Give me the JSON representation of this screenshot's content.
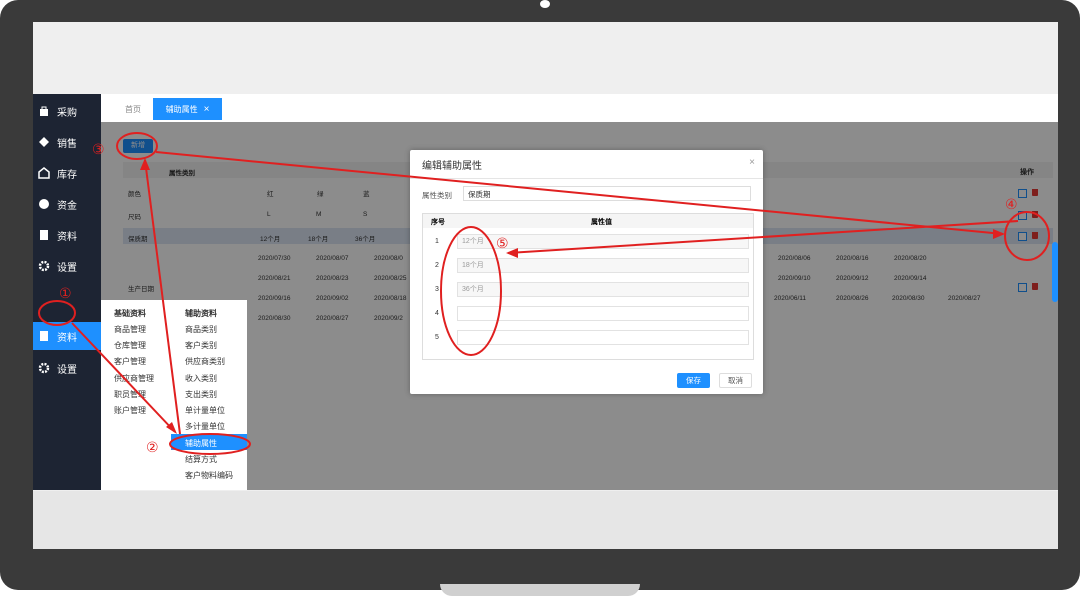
{
  "sidebar": {
    "items": [
      {
        "label": "采购",
        "icon": "bag-icon"
      },
      {
        "label": "销售",
        "icon": "tag-icon"
      },
      {
        "label": "库存",
        "icon": "warehouse-icon"
      },
      {
        "label": "资金",
        "icon": "coin-icon"
      },
      {
        "label": "资料",
        "icon": "document-icon"
      },
      {
        "label": "设置",
        "icon": "gear-icon"
      },
      {
        "label": "资料",
        "icon": "document-icon"
      },
      {
        "label": "设置",
        "icon": "gear-icon"
      }
    ]
  },
  "tabs": [
    {
      "label": "首页"
    },
    {
      "label": "辅助属性",
      "close": "×"
    }
  ],
  "toolbar": {
    "add_label": "新增"
  },
  "table": {
    "header_category": "属性类别",
    "header_ops": "操作",
    "rows": [
      {
        "category": "颜色",
        "values": [
          "红",
          "绿",
          "蓝"
        ]
      },
      {
        "category": "尺码",
        "values": [
          "L",
          "M",
          "S"
        ]
      },
      {
        "category": "保质期",
        "values": [
          "12个月",
          "18个月",
          "36个月"
        ]
      },
      {
        "category": "生产日期",
        "values": []
      }
    ],
    "date_rows": [
      [
        "2020/07/30",
        "2020/08/07",
        "2020/08/0"
      ],
      [
        "2020/08/21",
        "2020/08/23",
        "2020/08/25"
      ],
      [
        "2020/09/16",
        "2020/09/02",
        "2020/08/18"
      ],
      [
        "2020/08/30",
        "2020/08/27",
        "2020/09/2"
      ]
    ],
    "date_rows_right": [
      [
        "2020/08/06",
        "2020/08/16",
        "2020/08/20"
      ],
      [
        "2020/09/10",
        "2020/09/12",
        "2020/09/14"
      ],
      [
        "2020/06/11",
        "2020/08/26",
        "2020/08/30",
        "2020/08/27"
      ]
    ]
  },
  "menu": {
    "col1_header": "基础资料",
    "col1": [
      "商品管理",
      "仓库管理",
      "客户管理",
      "供应商管理",
      "职员管理",
      "账户管理"
    ],
    "col2_header": "辅助资料",
    "col2": [
      "商品类别",
      "客户类别",
      "供应商类别",
      "收入类别",
      "支出类别",
      "单计量单位",
      "多计量单位",
      "辅助属性",
      "结算方式",
      "客户物料编码"
    ]
  },
  "modal": {
    "title": "编辑辅助属性",
    "close": "×",
    "category_label": "属性类别",
    "category_value": "保质期",
    "col_index": "序号",
    "col_value": "属性值",
    "rows": [
      {
        "index": "1",
        "value": "12个月"
      },
      {
        "index": "2",
        "value": "18个月"
      },
      {
        "index": "3",
        "value": "36个月"
      },
      {
        "index": "4",
        "value": ""
      },
      {
        "index": "5",
        "value": ""
      }
    ],
    "save_label": "保存",
    "cancel_label": "取消"
  },
  "annotations": [
    "①",
    "②",
    "③",
    "④",
    "⑤"
  ],
  "colors": {
    "accent": "#1e90ff",
    "sidebar": "#1d2433",
    "annotation": "#e02020"
  }
}
